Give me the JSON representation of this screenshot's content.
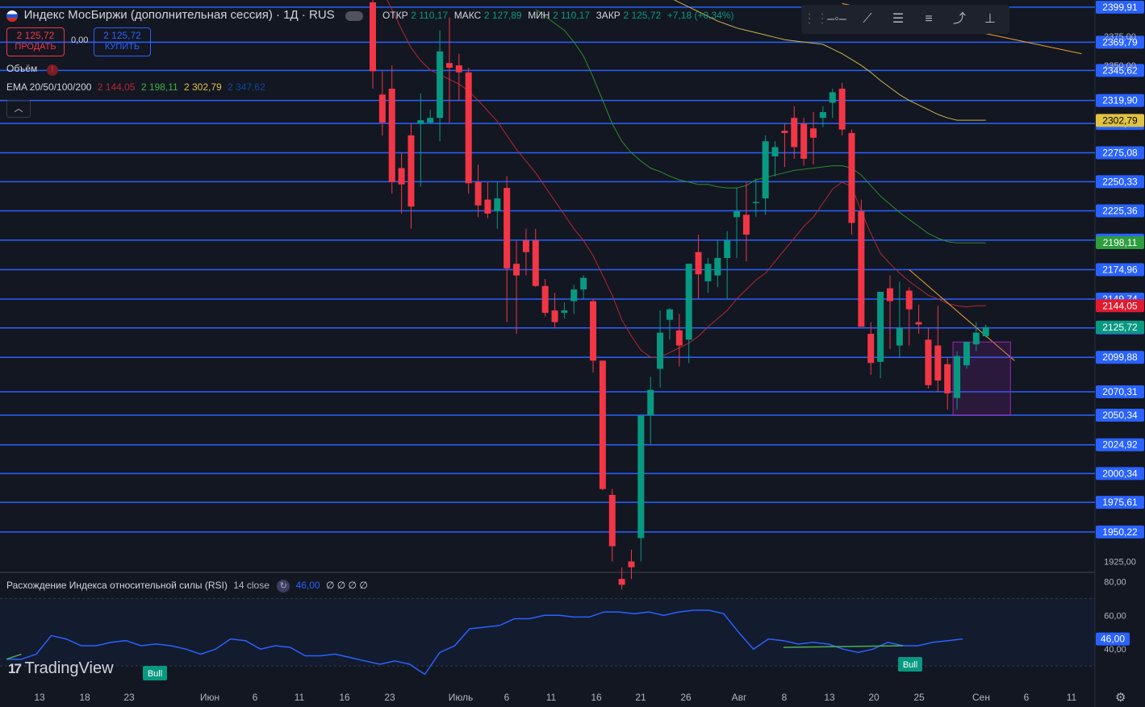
{
  "header": {
    "title": "Индекс МосБиржи (дополнительная сессия) · 1Д · RUS",
    "open_label": "ОТКР",
    "open": "2 110,17",
    "high_label": "МАКС",
    "high": "2 127,89",
    "low_label": "МИН",
    "low": "2 110,17",
    "close_label": "ЗАКР",
    "close": "2 125,72",
    "change": "+7,18 (+0,34%)"
  },
  "trade": {
    "sell_price": "2 125,72",
    "sell_label": "ПРОДАТЬ",
    "spread": "0,00",
    "buy_price": "2 125,72",
    "buy_label": "КУПИТЬ"
  },
  "indicators": {
    "volume_label": "Объём",
    "ema_label": "EMA 20/50/100/200",
    "ema20": "2 144,05",
    "ema50": "2 198,11",
    "ema100": "2 302,79",
    "ema200": "2 347,62",
    "rsi_label": "Расхождение Индекса относительной силы (RSI)",
    "rsi_params": "14 close",
    "rsi_value": "46,00",
    "rsi_extra": "∅ ∅ ∅ ∅"
  },
  "watermark": "TradingView",
  "colors": {
    "bg": "#131722",
    "up": "#089981",
    "down": "#f23645",
    "level": "#2962ff",
    "ema20": "#b22833",
    "ema50": "#2e8b2e",
    "ema100": "#c8b34a",
    "ema200": "#0d47a1",
    "rsi": "#2962ff",
    "trendline": "#f0a030"
  },
  "toolbar_icons": [
    "grip-icon",
    "horizontal-ray-icon",
    "trend-line-icon",
    "fib-icon",
    "long-position-icon",
    "path-icon",
    "measure-icon"
  ],
  "chart_data": {
    "type": "candlestick",
    "y_range": [
      1917,
      2406
    ],
    "price_ticks": [
      "2375,00",
      "2350,00",
      "1925,00"
    ],
    "levels": [
      "2399,91",
      "2369,79",
      "2345,62",
      "2319,90",
      "2300,22",
      "2275,08",
      "2250,33",
      "2225,36",
      "2200,26",
      "2174,96",
      "2149,74",
      "2125,03",
      "2099,88",
      "2070,31",
      "2050,34",
      "2024,92",
      "2000,34",
      "1975,61",
      "1950,22"
    ],
    "level_values": [
      2399.91,
      2369.79,
      2345.62,
      2319.9,
      2300.22,
      2275.08,
      2250.33,
      2225.36,
      2200.26,
      2174.96,
      2149.74,
      2125.03,
      2099.88,
      2070.31,
      2050.34,
      2024.92,
      2000.34,
      1975.61,
      1950.22
    ],
    "price_badges": [
      {
        "value": 2302.79,
        "label": "2302,79",
        "kind": "ema100"
      },
      {
        "value": 2198.11,
        "label": "2198,11",
        "kind": "ema50"
      },
      {
        "value": 2144.05,
        "label": "2144,05",
        "kind": "ema20"
      },
      {
        "value": 2125.72,
        "label": "2125,72",
        "kind": "last"
      }
    ],
    "x_labels": [
      "13",
      "18",
      "23",
      "Июн",
      "6",
      "11",
      "16",
      "23",
      "Июль",
      "6",
      "11",
      "16",
      "21",
      "26",
      "Авг",
      "8",
      "13",
      "20",
      "25",
      "Сен",
      "6",
      "11"
    ],
    "candles": [
      [
        2404,
        2410,
        2330,
        2345
      ],
      [
        2325,
        2345,
        2290,
        2301
      ],
      [
        2330,
        2350,
        2240,
        2250
      ],
      [
        2262,
        2275,
        2223,
        2248
      ],
      [
        2290,
        2300,
        2210,
        2229
      ],
      [
        2300,
        2326,
        2246,
        2303
      ],
      [
        2301,
        2312,
        2300,
        2305
      ],
      [
        2305,
        2380,
        2285,
        2362
      ],
      [
        2352,
        2391,
        2301,
        2348
      ],
      [
        2350,
        2360,
        2320,
        2344
      ],
      [
        2344,
        2348,
        2240,
        2249
      ],
      [
        2250,
        2265,
        2220,
        2230
      ],
      [
        2235,
        2250,
        2219,
        2223
      ],
      [
        2225,
        2250,
        2210,
        2236
      ],
      [
        2245,
        2255,
        2130,
        2176
      ],
      [
        2180,
        2200,
        2120,
        2170
      ],
      [
        2200,
        2210,
        2170,
        2190
      ],
      [
        2200,
        2210,
        2160,
        2161
      ],
      [
        2161,
        2167,
        2135,
        2138
      ],
      [
        2140,
        2155,
        2125,
        2130
      ],
      [
        2138,
        2147,
        2133,
        2140
      ],
      [
        2148,
        2162,
        2137,
        2158
      ],
      [
        2158,
        2170,
        2150,
        2168
      ],
      [
        2148,
        2150,
        2087,
        2097
      ],
      [
        2097,
        2097,
        1986,
        1987
      ],
      [
        1982,
        1987,
        1925,
        1938
      ],
      [
        1910,
        1920,
        1901,
        1905
      ],
      [
        1925,
        1935,
        1910,
        1920
      ],
      [
        1945,
        2050,
        1925,
        2050
      ],
      [
        2050,
        2083,
        2025,
        2072
      ],
      [
        2090,
        2140,
        2074,
        2121
      ],
      [
        2132,
        2142,
        2115,
        2141
      ],
      [
        2123,
        2137,
        2092,
        2110
      ],
      [
        2115,
        2180,
        2095,
        2180
      ],
      [
        2190,
        2205,
        2150,
        2171
      ],
      [
        2165,
        2185,
        2155,
        2180
      ],
      [
        2170,
        2200,
        2160,
        2185
      ],
      [
        2185,
        2208,
        2150,
        2200
      ],
      [
        2220,
        2245,
        2185,
        2225
      ],
      [
        2222,
        2250,
        2182,
        2205
      ],
      [
        2232,
        2253,
        2220,
        2233
      ],
      [
        2236,
        2290,
        2222,
        2285
      ],
      [
        2272,
        2285,
        2255,
        2280
      ],
      [
        2294,
        2300,
        2263,
        2292
      ],
      [
        2305,
        2315,
        2270,
        2280
      ],
      [
        2300,
        2305,
        2264,
        2270
      ],
      [
        2296,
        2310,
        2265,
        2288
      ],
      [
        2305,
        2315,
        2297,
        2310
      ],
      [
        2318,
        2330,
        2305,
        2327
      ],
      [
        2330,
        2335,
        2290,
        2295
      ],
      [
        2292,
        2295,
        2205,
        2215
      ],
      [
        2225,
        2235,
        2195,
        2126
      ],
      [
        2120,
        2130,
        2085,
        2095
      ],
      [
        2096,
        2140,
        2082,
        2156
      ],
      [
        2159,
        2170,
        2107,
        2148
      ],
      [
        2110,
        2165,
        2099,
        2125
      ],
      [
        2157,
        2160,
        2110,
        2141
      ],
      [
        2130,
        2145,
        2120,
        2128
      ],
      [
        2115,
        2125,
        2073,
        2076
      ],
      [
        2110,
        2144,
        2070,
        2080
      ],
      [
        2094,
        2100,
        2055,
        2069
      ],
      [
        2065,
        2105,
        2055,
        2101
      ],
      [
        2093,
        2112,
        2090,
        2113
      ],
      [
        2111,
        2130,
        2105,
        2121
      ],
      [
        2118,
        2128,
        2117,
        2125.72
      ]
    ],
    "ema": [
      {
        "name": "EMA 20",
        "color": "ema20",
        "values": [
          2430,
          2414,
          2398,
          2381,
          2365,
          2354,
          2346,
          2342,
          2338,
          2334,
          2328,
          2320,
          2311,
          2302,
          2290,
          2278,
          2268,
          2258,
          2246,
          2234,
          2222,
          2210,
          2200,
          2187,
          2170,
          2153,
          2132,
          2118,
          2106,
          2100,
          2100,
          2104,
          2108,
          2112,
          2118,
          2126,
          2133,
          2140,
          2150,
          2158,
          2166,
          2172,
          2182,
          2192,
          2202,
          2212,
          2220,
          2232,
          2244,
          2250,
          2246,
          2225,
          2206,
          2189,
          2180,
          2172,
          2165,
          2159,
          2153,
          2150,
          2146,
          2144,
          2143,
          2144,
          2144
        ]
      },
      {
        "name": "EMA 50",
        "color": "ema50",
        "values": [
          null,
          null,
          null,
          null,
          null,
          null,
          null,
          null,
          null,
          null,
          null,
          null,
          null,
          null,
          null,
          null,
          null,
          2398,
          2392,
          2386,
          2380,
          2370,
          2358,
          2340,
          2320,
          2300,
          2285,
          2275,
          2268,
          2262,
          2259,
          2255,
          2252,
          2250,
          2248,
          2248,
          2246,
          2245,
          2245,
          2247,
          2252,
          2254,
          2256,
          2258,
          2260,
          2261,
          2262,
          2263,
          2264,
          2264,
          2262,
          2256,
          2247,
          2238,
          2231,
          2224,
          2218,
          2212,
          2206,
          2202,
          2199,
          2198,
          2198,
          2198,
          2198
        ]
      },
      {
        "name": "EMA 100",
        "color": "ema100",
        "values": [
          null,
          null,
          null,
          null,
          null,
          null,
          null,
          null,
          null,
          null,
          null,
          null,
          null,
          null,
          null,
          null,
          null,
          null,
          null,
          null,
          null,
          null,
          null,
          null,
          null,
          null,
          null,
          null,
          null,
          null,
          null,
          2408,
          2404,
          2400,
          2396,
          2392,
          2388,
          2385,
          2382,
          2380,
          2378,
          2376,
          2374,
          2372,
          2371,
          2370,
          2369,
          2368,
          2364,
          2360,
          2355,
          2350,
          2344,
          2337,
          2331,
          2325,
          2320,
          2316,
          2312,
          2308,
          2305,
          2303,
          2303,
          2303,
          2303
        ]
      },
      {
        "name": "EMA 200",
        "color": "ema200",
        "values": [
          null,
          null,
          null,
          null,
          null,
          null,
          null,
          null,
          null,
          null,
          null,
          null,
          null,
          null,
          null,
          null,
          null,
          null,
          null,
          null,
          null,
          null,
          null,
          null,
          null,
          null,
          null,
          null,
          null,
          null,
          null,
          null,
          null,
          null,
          null,
          null,
          null,
          null,
          null,
          null,
          null,
          null,
          null,
          null,
          null,
          null,
          null,
          null,
          null,
          null,
          null,
          null,
          null,
          null,
          null,
          null,
          null,
          null,
          null,
          null,
          null,
          null,
          null,
          null,
          null
        ]
      }
    ],
    "trendlines": [
      {
        "from": [
          56,
          2175
        ],
        "to": [
          67,
          2097
        ],
        "color": "trendline"
      },
      {
        "from": [
          49,
          2403
        ],
        "to": [
          74,
          2360
        ],
        "color": "trendline"
      }
    ],
    "rsi": {
      "y_ticks": [
        "80,00",
        "60,00",
        "40,00"
      ],
      "band": [
        30,
        70
      ],
      "last": "46,00",
      "values": [
        34,
        34,
        37,
        48,
        46,
        42,
        42,
        44,
        45,
        42,
        43,
        42,
        40,
        37,
        40,
        46,
        45,
        40,
        42,
        41,
        36,
        36,
        37,
        35,
        33,
        31,
        33,
        31,
        25,
        38,
        42,
        52,
        53,
        54,
        58,
        58,
        60,
        60,
        59,
        59,
        62,
        62,
        61,
        62,
        60,
        62,
        63,
        63,
        61,
        50,
        40,
        46,
        45,
        43,
        44,
        43,
        40,
        38,
        40,
        44,
        42,
        42,
        44,
        45,
        46
      ],
      "signals": [
        {
          "index": 0,
          "label": "Bull"
        },
        {
          "index": 54,
          "label": "Bull"
        }
      ],
      "divergences": [
        [
          [
            0,
            34
          ],
          [
            1,
            37
          ]
        ],
        [
          [
            52,
            41
          ],
          [
            60,
            42
          ]
        ]
      ]
    }
  }
}
